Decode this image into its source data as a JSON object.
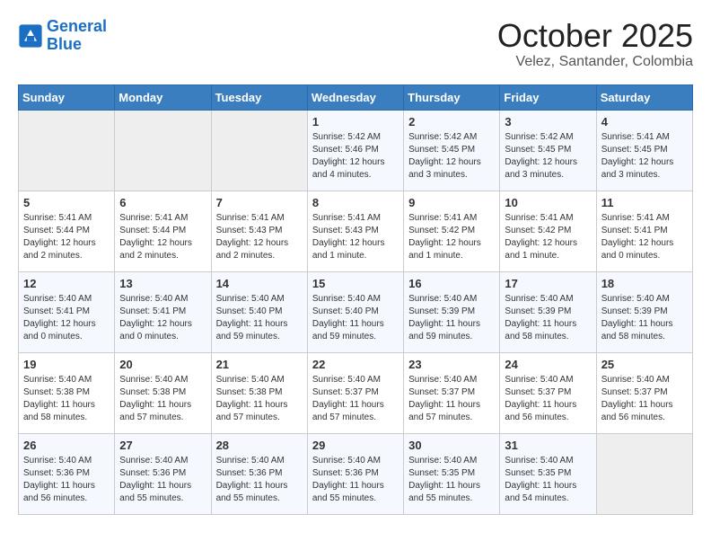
{
  "logo": {
    "line1": "General",
    "line2": "Blue"
  },
  "title": "October 2025",
  "location": "Velez, Santander, Colombia",
  "weekdays": [
    "Sunday",
    "Monday",
    "Tuesday",
    "Wednesday",
    "Thursday",
    "Friday",
    "Saturday"
  ],
  "weeks": [
    [
      {
        "day": "",
        "sunrise": "",
        "sunset": "",
        "daylight": ""
      },
      {
        "day": "",
        "sunrise": "",
        "sunset": "",
        "daylight": ""
      },
      {
        "day": "",
        "sunrise": "",
        "sunset": "",
        "daylight": ""
      },
      {
        "day": "1",
        "sunrise": "Sunrise: 5:42 AM",
        "sunset": "Sunset: 5:46 PM",
        "daylight": "Daylight: 12 hours and 4 minutes."
      },
      {
        "day": "2",
        "sunrise": "Sunrise: 5:42 AM",
        "sunset": "Sunset: 5:45 PM",
        "daylight": "Daylight: 12 hours and 3 minutes."
      },
      {
        "day": "3",
        "sunrise": "Sunrise: 5:42 AM",
        "sunset": "Sunset: 5:45 PM",
        "daylight": "Daylight: 12 hours and 3 minutes."
      },
      {
        "day": "4",
        "sunrise": "Sunrise: 5:41 AM",
        "sunset": "Sunset: 5:45 PM",
        "daylight": "Daylight: 12 hours and 3 minutes."
      }
    ],
    [
      {
        "day": "5",
        "sunrise": "Sunrise: 5:41 AM",
        "sunset": "Sunset: 5:44 PM",
        "daylight": "Daylight: 12 hours and 2 minutes."
      },
      {
        "day": "6",
        "sunrise": "Sunrise: 5:41 AM",
        "sunset": "Sunset: 5:44 PM",
        "daylight": "Daylight: 12 hours and 2 minutes."
      },
      {
        "day": "7",
        "sunrise": "Sunrise: 5:41 AM",
        "sunset": "Sunset: 5:43 PM",
        "daylight": "Daylight: 12 hours and 2 minutes."
      },
      {
        "day": "8",
        "sunrise": "Sunrise: 5:41 AM",
        "sunset": "Sunset: 5:43 PM",
        "daylight": "Daylight: 12 hours and 1 minute."
      },
      {
        "day": "9",
        "sunrise": "Sunrise: 5:41 AM",
        "sunset": "Sunset: 5:42 PM",
        "daylight": "Daylight: 12 hours and 1 minute."
      },
      {
        "day": "10",
        "sunrise": "Sunrise: 5:41 AM",
        "sunset": "Sunset: 5:42 PM",
        "daylight": "Daylight: 12 hours and 1 minute."
      },
      {
        "day": "11",
        "sunrise": "Sunrise: 5:41 AM",
        "sunset": "Sunset: 5:41 PM",
        "daylight": "Daylight: 12 hours and 0 minutes."
      }
    ],
    [
      {
        "day": "12",
        "sunrise": "Sunrise: 5:40 AM",
        "sunset": "Sunset: 5:41 PM",
        "daylight": "Daylight: 12 hours and 0 minutes."
      },
      {
        "day": "13",
        "sunrise": "Sunrise: 5:40 AM",
        "sunset": "Sunset: 5:41 PM",
        "daylight": "Daylight: 12 hours and 0 minutes."
      },
      {
        "day": "14",
        "sunrise": "Sunrise: 5:40 AM",
        "sunset": "Sunset: 5:40 PM",
        "daylight": "Daylight: 11 hours and 59 minutes."
      },
      {
        "day": "15",
        "sunrise": "Sunrise: 5:40 AM",
        "sunset": "Sunset: 5:40 PM",
        "daylight": "Daylight: 11 hours and 59 minutes."
      },
      {
        "day": "16",
        "sunrise": "Sunrise: 5:40 AM",
        "sunset": "Sunset: 5:39 PM",
        "daylight": "Daylight: 11 hours and 59 minutes."
      },
      {
        "day": "17",
        "sunrise": "Sunrise: 5:40 AM",
        "sunset": "Sunset: 5:39 PM",
        "daylight": "Daylight: 11 hours and 58 minutes."
      },
      {
        "day": "18",
        "sunrise": "Sunrise: 5:40 AM",
        "sunset": "Sunset: 5:39 PM",
        "daylight": "Daylight: 11 hours and 58 minutes."
      }
    ],
    [
      {
        "day": "19",
        "sunrise": "Sunrise: 5:40 AM",
        "sunset": "Sunset: 5:38 PM",
        "daylight": "Daylight: 11 hours and 58 minutes."
      },
      {
        "day": "20",
        "sunrise": "Sunrise: 5:40 AM",
        "sunset": "Sunset: 5:38 PM",
        "daylight": "Daylight: 11 hours and 57 minutes."
      },
      {
        "day": "21",
        "sunrise": "Sunrise: 5:40 AM",
        "sunset": "Sunset: 5:38 PM",
        "daylight": "Daylight: 11 hours and 57 minutes."
      },
      {
        "day": "22",
        "sunrise": "Sunrise: 5:40 AM",
        "sunset": "Sunset: 5:37 PM",
        "daylight": "Daylight: 11 hours and 57 minutes."
      },
      {
        "day": "23",
        "sunrise": "Sunrise: 5:40 AM",
        "sunset": "Sunset: 5:37 PM",
        "daylight": "Daylight: 11 hours and 57 minutes."
      },
      {
        "day": "24",
        "sunrise": "Sunrise: 5:40 AM",
        "sunset": "Sunset: 5:37 PM",
        "daylight": "Daylight: 11 hours and 56 minutes."
      },
      {
        "day": "25",
        "sunrise": "Sunrise: 5:40 AM",
        "sunset": "Sunset: 5:37 PM",
        "daylight": "Daylight: 11 hours and 56 minutes."
      }
    ],
    [
      {
        "day": "26",
        "sunrise": "Sunrise: 5:40 AM",
        "sunset": "Sunset: 5:36 PM",
        "daylight": "Daylight: 11 hours and 56 minutes."
      },
      {
        "day": "27",
        "sunrise": "Sunrise: 5:40 AM",
        "sunset": "Sunset: 5:36 PM",
        "daylight": "Daylight: 11 hours and 55 minutes."
      },
      {
        "day": "28",
        "sunrise": "Sunrise: 5:40 AM",
        "sunset": "Sunset: 5:36 PM",
        "daylight": "Daylight: 11 hours and 55 minutes."
      },
      {
        "day": "29",
        "sunrise": "Sunrise: 5:40 AM",
        "sunset": "Sunset: 5:36 PM",
        "daylight": "Daylight: 11 hours and 55 minutes."
      },
      {
        "day": "30",
        "sunrise": "Sunrise: 5:40 AM",
        "sunset": "Sunset: 5:35 PM",
        "daylight": "Daylight: 11 hours and 55 minutes."
      },
      {
        "day": "31",
        "sunrise": "Sunrise: 5:40 AM",
        "sunset": "Sunset: 5:35 PM",
        "daylight": "Daylight: 11 hours and 54 minutes."
      },
      {
        "day": "",
        "sunrise": "",
        "sunset": "",
        "daylight": ""
      }
    ]
  ]
}
